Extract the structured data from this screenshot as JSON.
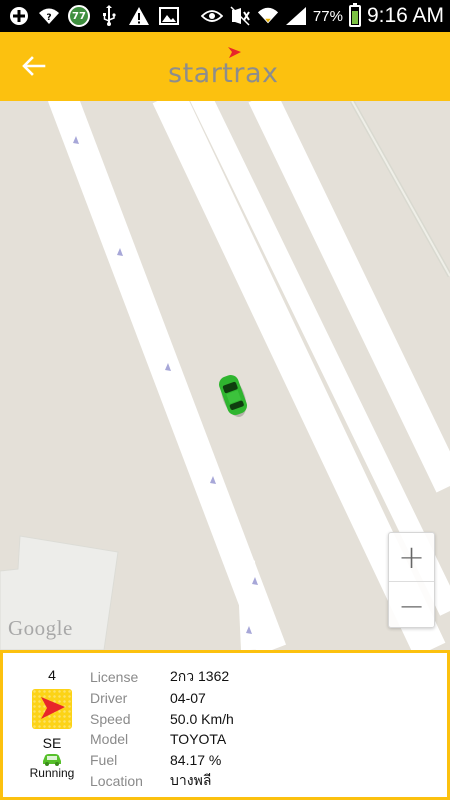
{
  "status_bar": {
    "notification_count": "77",
    "battery_percent": "77%",
    "time": "9:16 AM",
    "icons": [
      "plus-icon",
      "wifi-question-icon",
      "notification-count-icon",
      "usb-icon",
      "warning-icon",
      "image-icon",
      "eye-icon",
      "mute-icon",
      "wifi-icon",
      "signal-icon",
      "battery-charging-icon"
    ]
  },
  "header": {
    "logo_text": "startrax",
    "brand_color": "#fcc10f",
    "accent_color": "#e8262a"
  },
  "map": {
    "attribution": "Google",
    "zoom_in_label": "+",
    "zoom_out_label": "−",
    "vehicle_marker_color": "#2fb52f",
    "background_color": "#e4e0d8",
    "road_color": "#ffffff"
  },
  "vehicle": {
    "number": "4",
    "direction": "SE",
    "status": "Running",
    "status_color": "#56c02a",
    "details": [
      {
        "label": "License",
        "value": "2กว 1362"
      },
      {
        "label": "Driver",
        "value": "04-07"
      },
      {
        "label": "Speed",
        "value": "50.0 Km/h"
      },
      {
        "label": "Model",
        "value": "TOYOTA"
      },
      {
        "label": "Fuel",
        "value": "84.17 %"
      },
      {
        "label": "Location",
        "value": "บางพลี"
      }
    ]
  }
}
